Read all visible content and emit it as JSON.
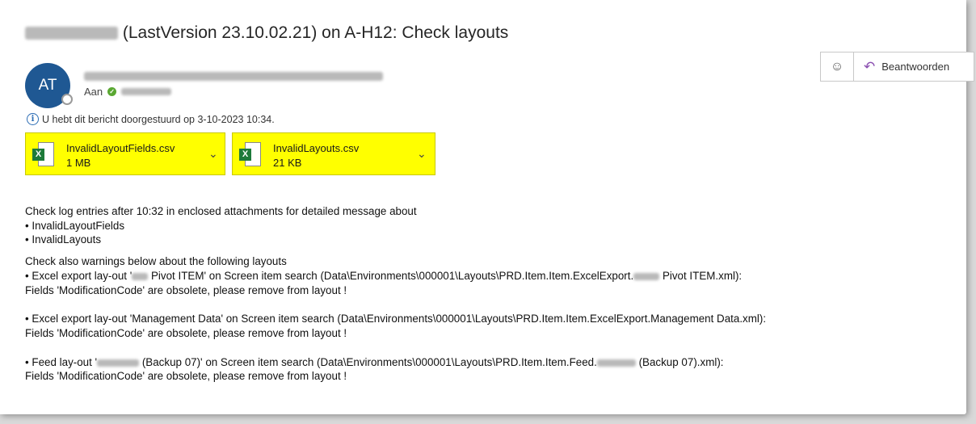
{
  "email": {
    "subject_text": "(LastVersion 23.10.02.21) on A-H12: Check layouts",
    "avatar_initials": "AT",
    "to_label": "Aan",
    "forward_notice": "U hebt dit bericht doorgestuurd op 3-10-2023 10:34.",
    "reply_label": "Beantwoorden"
  },
  "attachments": [
    {
      "name": "InvalidLayoutFields.csv",
      "size": "1 MB"
    },
    {
      "name": "InvalidLayouts.csv",
      "size": "21 KB"
    }
  ],
  "body": {
    "intro": "Check log entries after 10:32 in enclosed attachments for detailed message about",
    "bullets": [
      "• InvalidLayoutFields",
      "• InvalidLayouts"
    ],
    "warnings_intro": "Check also warnings below about the following layouts",
    "w1_a": "• Excel export lay-out '",
    "w1_b": " Pivot ITEM' on Screen item search (Data\\Environments\\000001\\Layouts\\PRD.Item.Item.ExcelExport.",
    "w1_c": " Pivot ITEM.xml):",
    "w1_fields": "Fields 'ModificationCode' are obsolete, please remove from layout !",
    "w2": "• Excel export lay-out 'Management Data' on Screen item search (Data\\Environments\\000001\\Layouts\\PRD.Item.Item.ExcelExport.Management Data.xml):",
    "w2_fields": "Fields 'ModificationCode' are obsolete, please remove from layout !",
    "w3_a": "• Feed lay-out '",
    "w3_b": " (Backup 07)' on Screen item search (Data\\Environments\\000001\\Layouts\\PRD.Item.Item.Feed.",
    "w3_c": " (Backup 07).xml):",
    "w3_fields": "Fields 'ModificationCode' are obsolete, please remove from layout !"
  },
  "colors": {
    "highlight": "#ffff00",
    "avatar": "#1f5893",
    "excel": "#1d7a3a"
  }
}
